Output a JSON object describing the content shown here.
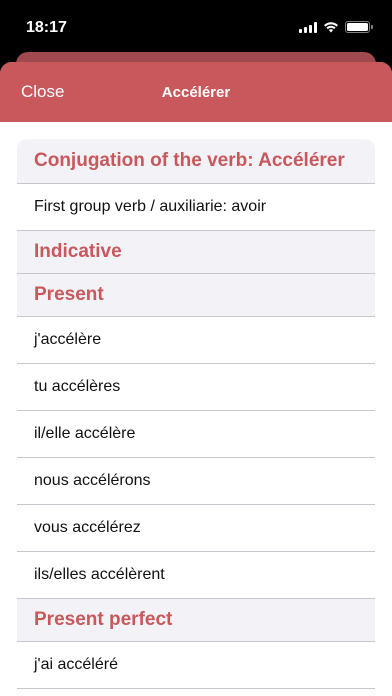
{
  "status": {
    "time": "18:17"
  },
  "nav": {
    "close_label": "Close",
    "title": "Accélérer"
  },
  "conjugation": {
    "heading": "Conjugation of the verb: Accélérer",
    "info": "First group verb / auxiliarie: avoir",
    "mood": "Indicative",
    "present": {
      "heading": "Present",
      "forms": [
        "j'accélère",
        "tu accélères",
        "il/elle accélère",
        "nous accélérons",
        "vous accélérez",
        "ils/elles accélèrent"
      ]
    },
    "present_perfect": {
      "heading": "Present perfect",
      "forms": [
        "j'ai accéléré"
      ]
    }
  },
  "colors": {
    "accent": "#c8585c",
    "header_bg": "#f2f2f7",
    "status_bg": "#000000"
  }
}
